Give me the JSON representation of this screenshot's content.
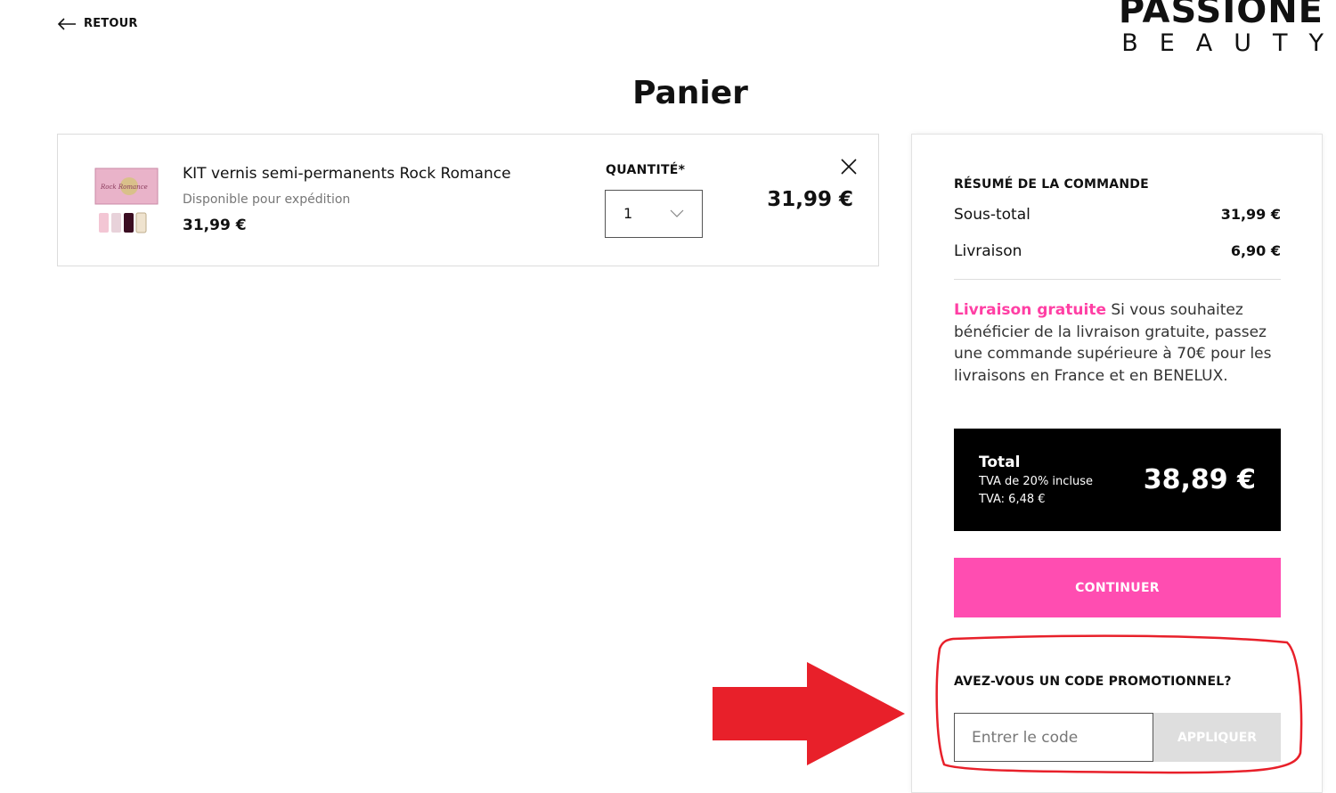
{
  "nav": {
    "back_label": "RETOUR"
  },
  "brand": {
    "line1": "PASSIONE",
    "line2": "BEAUTY"
  },
  "page": {
    "title": "Panier"
  },
  "cart": {
    "item": {
      "name": "KIT vernis semi-permanents Rock Romance",
      "availability": "Disponible pour expédition",
      "unit_price": "31,99 €",
      "line_total": "31,99 €",
      "thumbnail_box_text": "Rock Romance"
    },
    "quantity_label": "QUANTITÉ*",
    "quantity_value": "1"
  },
  "summary": {
    "heading": "RÉSUMÉ DE LA COMMANDE",
    "subtotal_label": "Sous-total",
    "subtotal_value": "31,99 €",
    "shipping_label": "Livraison",
    "shipping_value": "6,90 €",
    "free_shipping_highlight": "Livraison gratuite",
    "free_shipping_text": " Si vous souhaitez bénéficier de la livraison gratuite, passez une commande supérieure à 70€ pour les livraisons en France et en BENELUX.",
    "total_label": "Total",
    "vat_note": "TVA de 20% incluse",
    "vat_amount": "TVA: 6,48 €",
    "total_value": "38,89 €",
    "continue_label": "CONTINUER",
    "promo_question": "AVEZ-VOUS UN CODE PROMOTIONNEL?",
    "promo_placeholder": "Entrer le code",
    "apply_label": "APPLIQUER"
  },
  "colors": {
    "accent_pink": "#ff4db1",
    "annotation_red": "#e8202a"
  }
}
